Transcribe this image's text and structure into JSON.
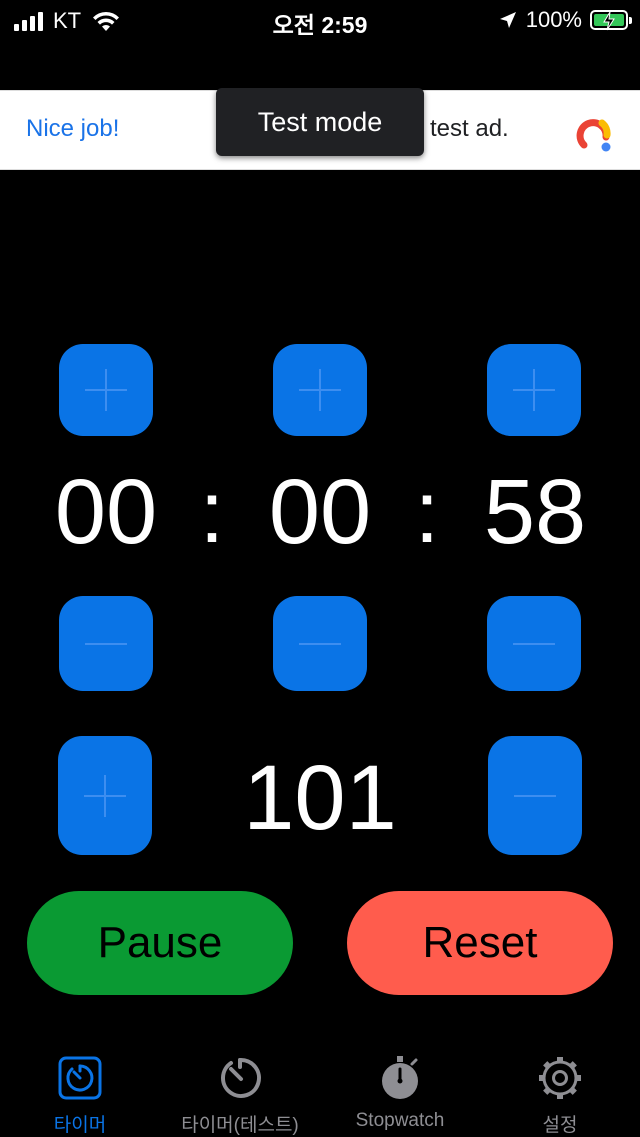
{
  "status_bar": {
    "carrier": "KT",
    "time": "오전 2:59",
    "battery": "100%"
  },
  "ad": {
    "left_text": "Nice job!",
    "right_text": "test ad.",
    "overlay": "Test mode"
  },
  "timer": {
    "hours": "00",
    "minutes": "00",
    "seconds": "58",
    "separator": ":",
    "count": "101"
  },
  "controls": {
    "pause": "Pause",
    "reset": "Reset"
  },
  "tabs": [
    {
      "label": "타이머",
      "icon": "timer-icon",
      "active": true
    },
    {
      "label": "타이머(테스트)",
      "icon": "dial-icon",
      "active": false
    },
    {
      "label": "Stopwatch",
      "icon": "stopwatch-icon",
      "active": false
    },
    {
      "label": "설정",
      "icon": "gear-icon",
      "active": false
    }
  ],
  "colors": {
    "accent_blue": "#0a74e6",
    "pause_green": "#0a9a33",
    "reset_red": "#ff5c4d",
    "inactive_gray": "#8e8e93"
  }
}
